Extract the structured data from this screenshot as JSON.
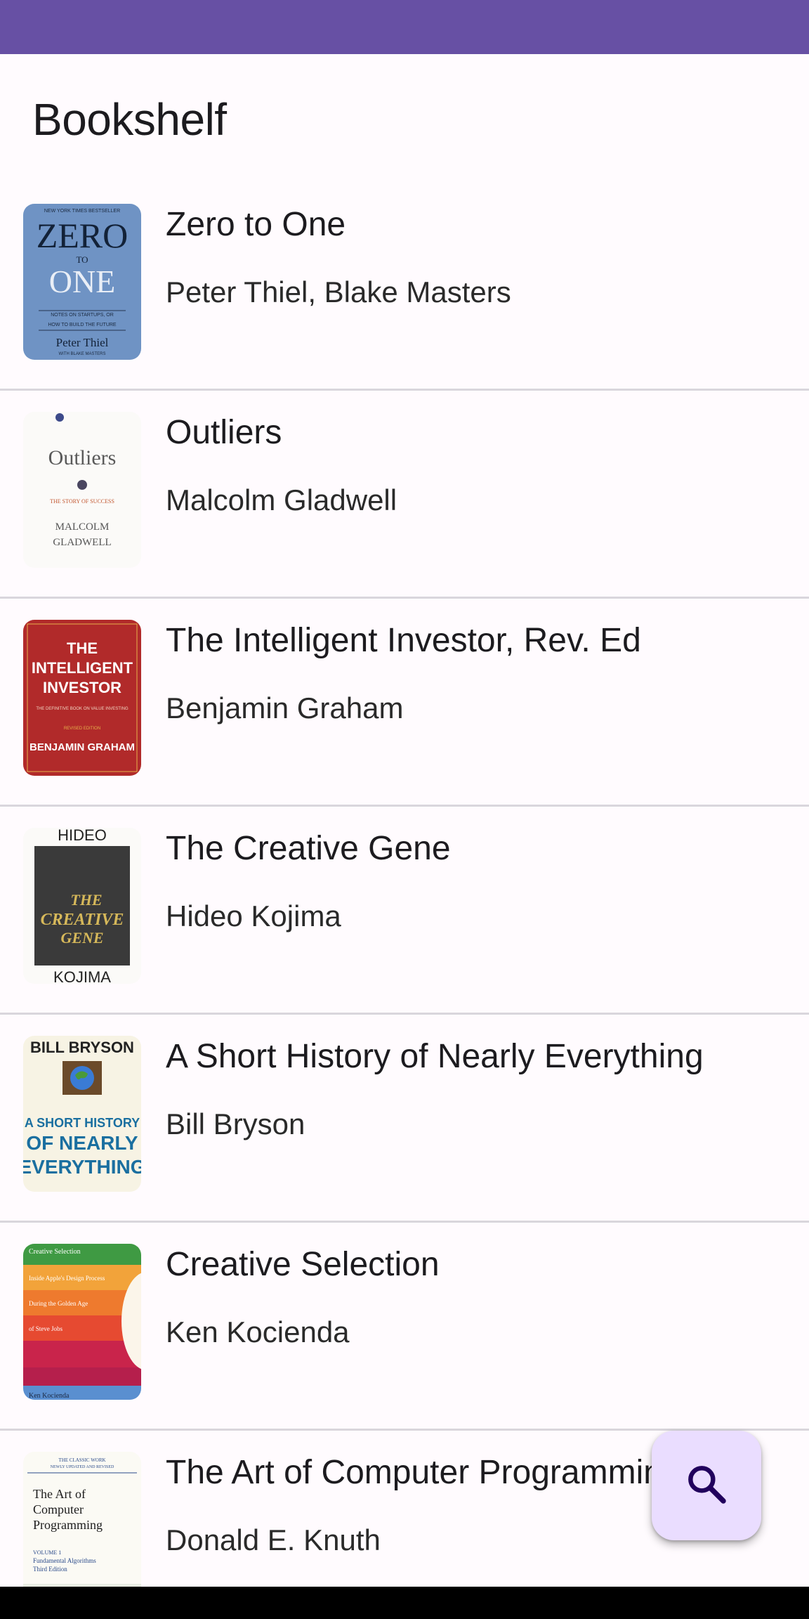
{
  "app": {
    "title": "Bookshelf"
  },
  "books": [
    {
      "title": "Zero to One",
      "author": "Peter Thiel, Blake Masters",
      "cover": {
        "lines": [
          "ZERO",
          "TO",
          "ONE",
          "NOTES ON STARTUPS, OR",
          "HOW TO BUILD THE FUTURE",
          "Peter Thiel",
          "NEW YORK TIMES BESTSELLER",
          "WITH BLAKE MASTERS"
        ]
      }
    },
    {
      "title": "Outliers",
      "author": "Malcolm Gladwell",
      "cover": {
        "lines": [
          "Outliers",
          "THE STORY OF SUCCESS",
          "MALCOLM",
          "GLADWELL"
        ]
      }
    },
    {
      "title": "The Intelligent Investor, Rev. Ed",
      "author": "Benjamin Graham",
      "cover": {
        "lines": [
          "THE",
          "INTELLIGENT",
          "INVESTOR",
          "THE DEFINITIVE BOOK ON VALUE INVESTING",
          "REVISED EDITION",
          "BENJAMIN GRAHAM"
        ]
      }
    },
    {
      "title": "The Creative Gene",
      "author": "Hideo Kojima",
      "cover": {
        "lines": [
          "HIDEO",
          "THE",
          "CREATIVE",
          "GENE",
          "KOJIMA"
        ]
      }
    },
    {
      "title": "A Short History of Nearly Everything",
      "author": "Bill Bryson",
      "cover": {
        "lines": [
          "BILL BRYSON",
          "A SHORT HISTORY",
          "OF NEARLY",
          "EVERYTHING"
        ]
      }
    },
    {
      "title": "Creative Selection",
      "author": "Ken Kocienda",
      "cover": {
        "lines": [
          "Creative Selection",
          "Inside Apple's Design Process",
          "During the Golden Age",
          "of Steve Jobs",
          "Ken Kocienda"
        ]
      }
    },
    {
      "title": "The Art of Computer Programming",
      "author": "Donald E. Knuth",
      "cover": {
        "lines": [
          "THE CLASSIC WORK",
          "NEWLY UPDATED AND REVISED",
          "The Art of",
          "Computer",
          "Programming",
          "VOLUME 1",
          "Fundamental Algorithms",
          "Third Edition"
        ]
      }
    }
  ],
  "fab": {
    "icon": "search-icon",
    "color": "#eaddff"
  },
  "colors": {
    "status_bar": "#6750a4",
    "background": "#fffbfe",
    "divider": "#d9d6dc"
  }
}
